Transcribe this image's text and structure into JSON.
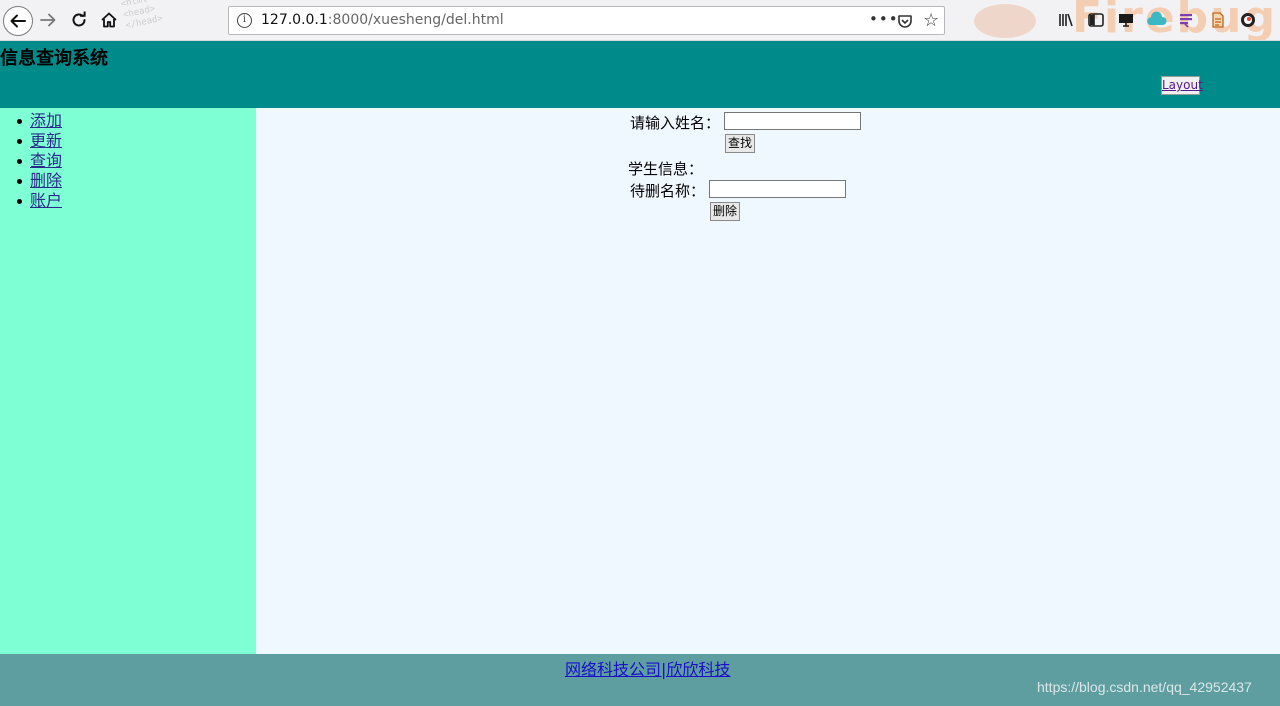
{
  "browser": {
    "url_host": "127.0.0.1",
    "url_path": ":8000/xuesheng/del.html",
    "menu_dots": "•••",
    "info_glyph": "i",
    "deco_text": "Firebug"
  },
  "header": {
    "title": "信息查询系统",
    "layout_button": "Layout",
    "background": "#008b8b"
  },
  "sidebar": {
    "background": "#7fffd4",
    "items": [
      {
        "label": "添加"
      },
      {
        "label": "更新"
      },
      {
        "label": "查询"
      },
      {
        "label": "删除"
      },
      {
        "label": "账户"
      }
    ]
  },
  "main": {
    "background": "#f0f8ff",
    "search": {
      "label": "请输入姓名：",
      "value": "",
      "button": "查找"
    },
    "student_info_label": "学生信息：",
    "delete": {
      "label": "待删名称：",
      "value": "",
      "button": "删除"
    }
  },
  "footer": {
    "background": "#5f9ea0",
    "link": "网络科技公司|欣欣科技",
    "watermark": "https://blog.csdn.net/qq_42952437"
  },
  "icons": [
    "back-arrow-icon",
    "forward-arrow-icon",
    "reload-icon",
    "home-icon",
    "info-icon",
    "pocket-icon",
    "star-icon",
    "library-icon",
    "sidebar-icon",
    "monitor-icon",
    "cloud-icon",
    "menu-list-icon",
    "document-icon",
    "profile-icon"
  ]
}
